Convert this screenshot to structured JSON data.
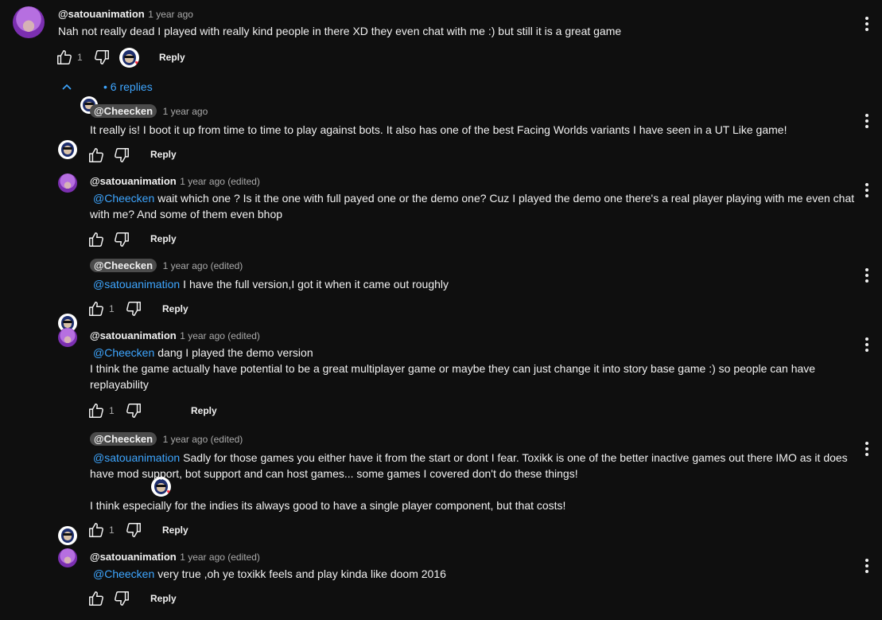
{
  "comment": {
    "author": "@satouanimation",
    "time": "1 year ago",
    "text": "Nah not really dead I played with really kind people in there XD they even chat with me :) but still it is a great game",
    "likes": "1",
    "reply_label": "Reply",
    "replies_label": "6 replies"
  },
  "replies": [
    {
      "author": "@Cheecken",
      "time": "1 year ago",
      "mention": "",
      "lines": [
        "It really is! I boot it up from time to time to play against bots. It also has one of the best Facing Worlds variants I have seen in a UT Like game!"
      ],
      "likes": "",
      "reply_label": "Reply"
    },
    {
      "author": "@satouanimation",
      "time": "1 year ago (edited)",
      "mention": "@Cheecken",
      "lines": [
        "wait which one ? Is it the one with full payed one or the demo one? Cuz I played the demo one there's a real player playing with me even chat",
        "with me? And some of them even bhop"
      ],
      "likes": "",
      "reply_label": "Reply"
    },
    {
      "author": "@Cheecken",
      "time": "1 year ago (edited)",
      "mention": "@satouanimation",
      "lines": [
        "I have the full version,I got it when it came out roughly"
      ],
      "likes": "1",
      "reply_label": "Reply"
    },
    {
      "author": "@satouanimation",
      "time": "1 year ago (edited)",
      "mention": "@Cheecken",
      "lines": [
        "dang I played the demo version",
        "I think the game actually have potential to be a great multiplayer game or maybe they can just change it into story base game :) so people can have",
        "replayability"
      ],
      "likes": "1",
      "reply_label": "Reply"
    },
    {
      "author": "@Cheecken",
      "time": "1 year ago (edited)",
      "mention": "@satouanimation",
      "lines": [
        "Sadly for those games you either have it from the start or dont I fear. Toxikk is one of the better inactive games out there IMO as it does",
        "have mod support, bot support and can host games... some games I covered don't do these things!",
        "",
        "I think especially for the indies its always good to have a single player component, but that costs!"
      ],
      "likes": "1",
      "reply_label": "Reply"
    },
    {
      "author": "@satouanimation",
      "time": "1 year ago (edited)",
      "mention": "@Cheecken",
      "lines": [
        "very true ,oh ye toxikk feels and play kinda like doom 2016"
      ],
      "likes": "",
      "reply_label": "Reply"
    }
  ],
  "icons": {
    "like": "thumb-up-icon",
    "dislike": "thumb-down-icon",
    "more": "more-vert-icon",
    "collapse": "chevron-up-icon",
    "creator_heart": "creator-heart-icon"
  },
  "colors": {
    "background": "#0f0f0f",
    "text": "#f1f1f1",
    "secondary": "#aaaaaa",
    "link": "#3ea6ff",
    "author_chip": "#4b4b4b"
  }
}
